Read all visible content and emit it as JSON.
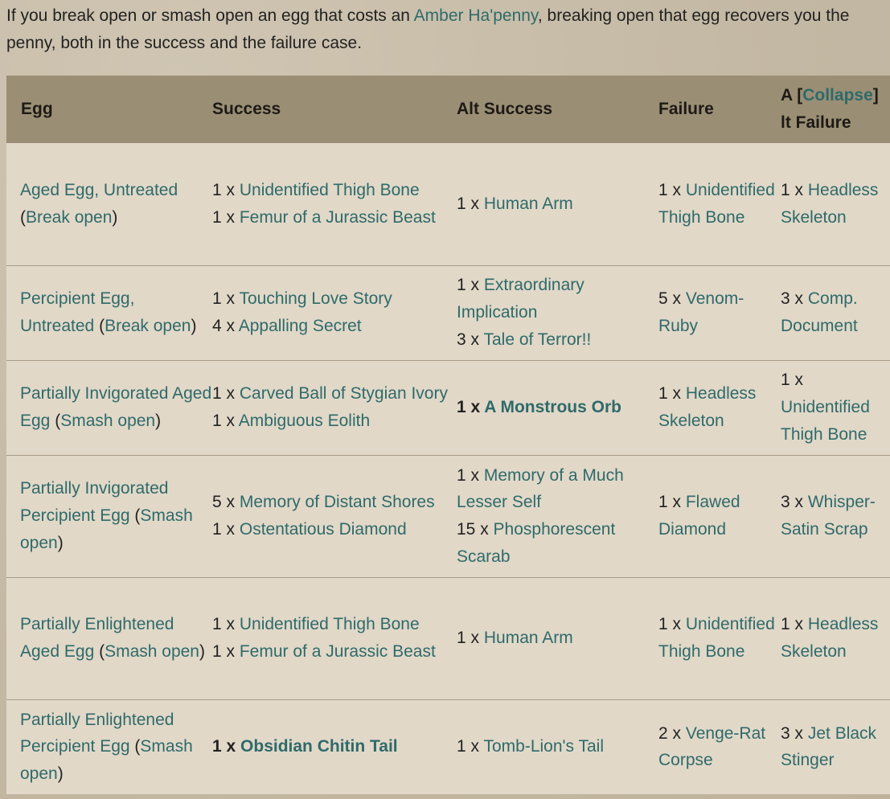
{
  "intro": {
    "prefix": "If you break open or smash open an egg that costs an ",
    "link": "Amber Ha'penny",
    "suffix": ", breaking open that egg recovers you the penny, both in the success and the failure case."
  },
  "table": {
    "headers": {
      "egg": "Egg",
      "success": "Success",
      "alt_success": "Alt Success",
      "failure": "Failure",
      "alt_failure_a": "A",
      "collapse_open": "[",
      "collapse": "Collapse",
      "collapse_close": "]",
      "alt_failure_b": "lt Failure"
    },
    "rows": [
      {
        "egg_name": "Aged Egg, Untreated",
        "egg_action": "Break open",
        "success": [
          {
            "qty": "1 x ",
            "item": "Unidentified Thigh Bone"
          },
          {
            "qty": "1 x ",
            "item": "Femur of a Jurassic Beast"
          }
        ],
        "alt": [
          {
            "qty": "1 x ",
            "item": "Human Arm"
          }
        ],
        "failure": [
          {
            "qty": "1 x ",
            "item": "Unidentified Thigh Bone"
          }
        ],
        "alt_failure": [
          {
            "qty": "1 x ",
            "item": "Headless Skeleton"
          }
        ]
      },
      {
        "egg_name": "Percipient Egg, Untreated",
        "egg_action": "Break open",
        "success": [
          {
            "qty": "1 x ",
            "item": "Touching Love Story"
          },
          {
            "qty": "4 x ",
            "item": "Appalling Secret"
          }
        ],
        "alt": [
          {
            "qty": "1 x ",
            "item": "Extraordinary Implication"
          },
          {
            "qty": "3 x ",
            "item": "Tale of Terror!!"
          }
        ],
        "failure": [
          {
            "qty": "5 x ",
            "item": "Venom-Ruby"
          }
        ],
        "alt_failure": [
          {
            "qty": "3 x ",
            "item": "Comp. Document"
          }
        ]
      },
      {
        "egg_name": "Partially Invigorated Aged Egg",
        "egg_action": "Smash open",
        "success": [
          {
            "qty": "1 x ",
            "item": "Carved Ball of Stygian Ivory"
          },
          {
            "qty": "1 x ",
            "item": "Ambiguous Eolith"
          }
        ],
        "alt": [
          {
            "qty": "1 x ",
            "item": "A Monstrous Orb",
            "bold": true
          }
        ],
        "failure": [
          {
            "qty": "1 x ",
            "item": "Headless Skeleton"
          }
        ],
        "alt_failure": [
          {
            "qty": "1 x ",
            "item": "Unidentified Thigh Bone"
          }
        ]
      },
      {
        "egg_name": "Partially Invigorated Percipient Egg",
        "egg_action": "Smash open",
        "success": [
          {
            "qty": "5 x ",
            "item": "Memory of Distant Shores"
          },
          {
            "qty": "1 x ",
            "item": "Ostentatious Diamond"
          }
        ],
        "alt": [
          {
            "qty": "1 x ",
            "item": "Memory of a Much Lesser Self"
          },
          {
            "qty": "15 x ",
            "item": "Phosphorescent Scarab"
          }
        ],
        "failure": [
          {
            "qty": "1 x ",
            "item": "Flawed Diamond"
          }
        ],
        "alt_failure": [
          {
            "qty": "3 x ",
            "item": "Whisper-Satin Scrap"
          }
        ]
      },
      {
        "egg_name": "Partially Enlightened Aged Egg",
        "egg_action": "Smash open",
        "success": [
          {
            "qty": "1 x ",
            "item": "Unidentified Thigh Bone"
          },
          {
            "qty": "1 x ",
            "item": "Femur of a Jurassic Beast"
          }
        ],
        "alt": [
          {
            "qty": "1 x ",
            "item": "Human Arm"
          }
        ],
        "failure": [
          {
            "qty": "1 x ",
            "item": "Unidentified Thigh Bone"
          }
        ],
        "alt_failure": [
          {
            "qty": "1 x ",
            "item": "Headless Skeleton"
          }
        ]
      },
      {
        "egg_name": "Partially Enlightened Percipient Egg",
        "egg_action": "Smash open",
        "success": [
          {
            "qty": "1 x ",
            "item": "Obsidian Chitin Tail",
            "bold": true
          }
        ],
        "alt": [
          {
            "qty": "1 x ",
            "item": "Tomb-Lion's Tail"
          }
        ],
        "failure": [
          {
            "qty": "2 x ",
            "item": "Venge-Rat Corpse"
          }
        ],
        "alt_failure": [
          {
            "qty": "3 x ",
            "item": "Jet Black Stinger"
          }
        ]
      }
    ]
  }
}
